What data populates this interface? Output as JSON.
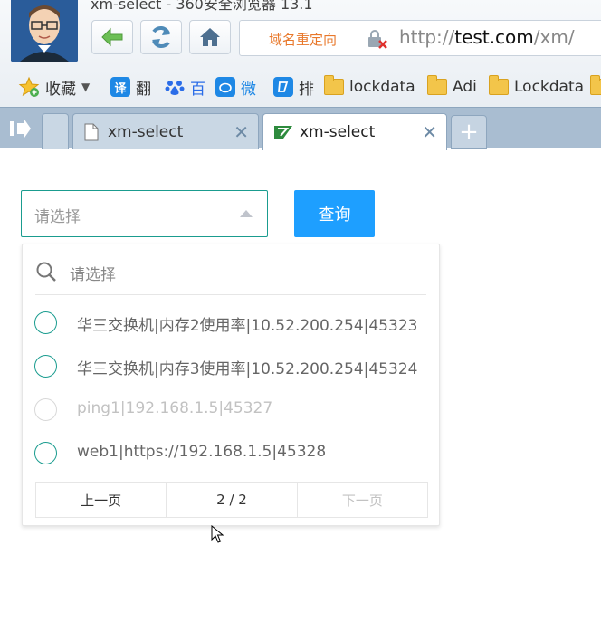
{
  "window": {
    "title": "xm-select - 360安全浏览器 13.1"
  },
  "toolbar": {
    "url_redirect_hint": "域名重定向",
    "url_prefix": "http://",
    "url_host": "test.com",
    "url_path": "/xm/"
  },
  "bookmarks": [
    {
      "label": "收藏",
      "icon": "star-icon"
    },
    {
      "label": "翻",
      "icon": "translate-icon",
      "badge": "译",
      "color": "#1e88e5"
    },
    {
      "label": "百",
      "icon": "baidu-icon",
      "color": "#2b6de8"
    },
    {
      "label": "微",
      "icon": "weibo-icon",
      "color": "#1e88e5"
    },
    {
      "label": "排",
      "icon": "sort-icon",
      "color": "#1e88e5"
    },
    {
      "label": "lockdata",
      "icon": "folder-icon"
    },
    {
      "label": "Adi",
      "icon": "folder-icon"
    },
    {
      "label": "Lockdata",
      "icon": "folder-icon"
    }
  ],
  "tabs": [
    {
      "title": "xm-select",
      "active": false
    },
    {
      "title": "xm-select",
      "active": true
    }
  ],
  "page": {
    "select_placeholder": "请选择",
    "query_button": "查询",
    "dropdown": {
      "search_placeholder": "请选择",
      "options": [
        {
          "label": "华三交换机|内存2使用率|10.52.200.254|45323",
          "disabled": false
        },
        {
          "label": "华三交换机|内存3使用率|10.52.200.254|45324",
          "disabled": false
        },
        {
          "label": "ping1|192.168.1.5|45327",
          "disabled": true
        },
        {
          "label": "web1|https://192.168.1.5|45328",
          "disabled": false
        }
      ],
      "pager": {
        "prev": "上一页",
        "page_info": "2 / 2",
        "next": "下一页",
        "next_disabled": true
      }
    }
  },
  "colors": {
    "accent": "#1a9c8f",
    "primary_button": "#1e9fff"
  }
}
